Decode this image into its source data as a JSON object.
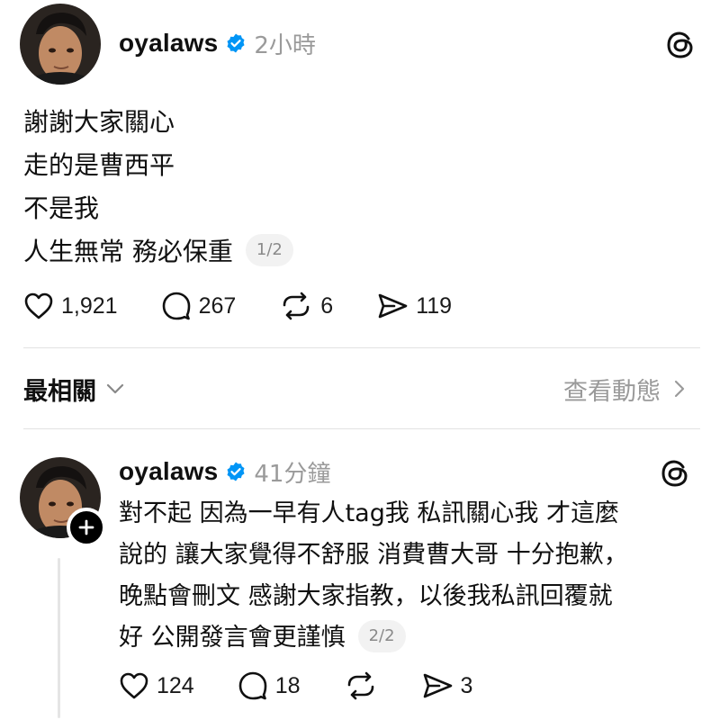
{
  "colors": {
    "verified_blue": "#0095f6",
    "text": "#101010",
    "muted": "#9a9a9a",
    "divider": "#e2e2e2"
  },
  "post": {
    "username": "oyalaws",
    "timestamp": "2小時",
    "lines": [
      "謝謝大家關心",
      "走的是曹西平",
      "不是我",
      "人生無常 務必保重"
    ],
    "page_indicator": "1/2",
    "likes": "1,921",
    "replies": "267",
    "reposts": "6",
    "shares": "119"
  },
  "sort": {
    "label": "最相關",
    "activity_link": "查看動態"
  },
  "reply": {
    "username": "oyalaws",
    "timestamp": "41分鐘",
    "lines": [
      "對不起 因為一早有人tag我 私訊關心我 才這麼",
      "說的 讓大家覺得不舒服 消費曹大哥 十分抱歉，",
      "晚點會刪文 感謝大家指教，以後我私訊回覆就",
      "好 公開發言會更謹慎"
    ],
    "page_indicator": "2/2",
    "likes": "124",
    "replies": "18",
    "shares": "3"
  },
  "icons": [
    "verified-badge-icon",
    "threads-logo-icon",
    "heart-icon",
    "comment-icon",
    "repost-icon",
    "share-icon",
    "chevron-down-icon",
    "chevron-right-icon",
    "plus-icon"
  ]
}
